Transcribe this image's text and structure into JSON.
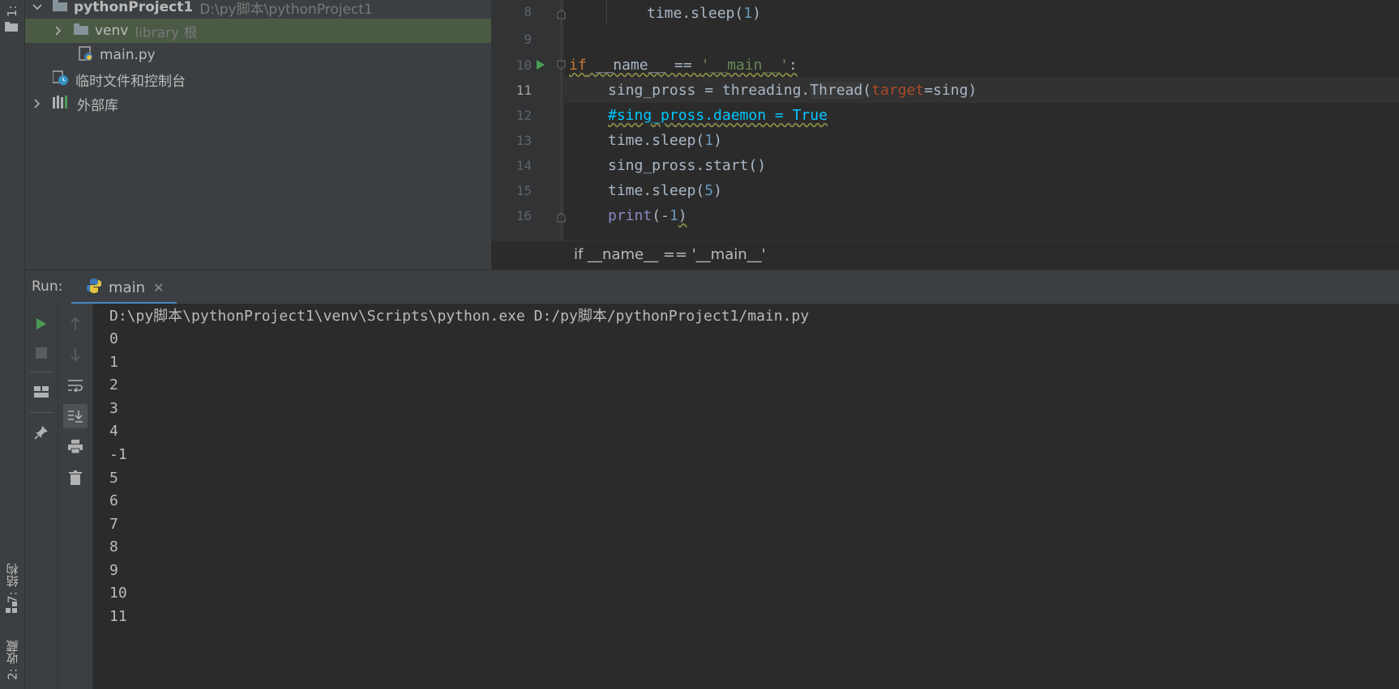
{
  "left_strip": {
    "top_tab": "1:",
    "structure_tab": "7: 结构",
    "favorites_tab": "2: 收藏"
  },
  "project_tree": {
    "root": {
      "name": "pythonProject1",
      "path": "D:\\py脚本\\pythonProject1"
    },
    "venv": {
      "name": "venv",
      "hint": "library 根"
    },
    "main_file": "main.py",
    "scratches": "临时文件和控制台",
    "external_libs": "外部库"
  },
  "editor": {
    "line_numbers": [
      "8",
      "9",
      "10",
      "11",
      "12",
      "13",
      "14",
      "15",
      "16"
    ],
    "current_line": "11",
    "code": {
      "l8": [
        "time.sleep(",
        "1",
        ")"
      ],
      "l10": [
        "if",
        " __name__ == ",
        "'__main__'",
        ":"
      ],
      "l11": [
        "sing_pross = threading.",
        "Thread",
        "(",
        "target",
        "=sing)"
      ],
      "l12": "#sing_pross.daemon = True",
      "l13": [
        "time.sleep(",
        "1",
        ")"
      ],
      "l14": "sing_pross.start()",
      "l15": [
        "time.sleep(",
        "5",
        ")"
      ],
      "l16": [
        "print",
        "(-",
        "1",
        ")"
      ]
    },
    "breadcrumb": "if __name__ == '__main__'"
  },
  "run_panel": {
    "label": "Run:",
    "tab_name": "main",
    "command": "D:\\py脚本\\pythonProject1\\venv\\Scripts\\python.exe D:/py脚本/pythonProject1/main.py",
    "output": [
      "0",
      "1",
      "2",
      "3",
      "4",
      "-1",
      "5",
      "6",
      "7",
      "8",
      "9",
      "10",
      "11"
    ]
  },
  "colors": {
    "accent": "#4a88c7",
    "run_green": "#499c54",
    "selection": "#4b5a45"
  }
}
